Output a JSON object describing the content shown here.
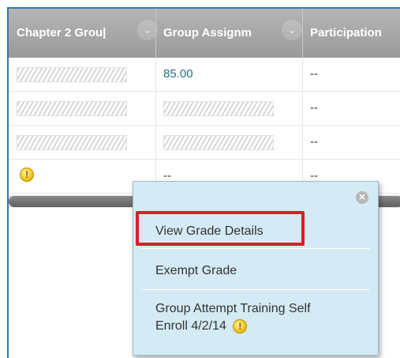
{
  "columns": [
    {
      "label": "Chapter 2 Grou|"
    },
    {
      "label": "Group Assignm"
    },
    {
      "label": "Participation"
    }
  ],
  "icons": {
    "sort": "chevron-down-icon",
    "warning": "exclamation-warning-icon",
    "close": "close-icon"
  },
  "rows": [
    {
      "col2": "85.00",
      "col3": "--"
    },
    {
      "col3": "--"
    },
    {
      "col3": "--"
    },
    {
      "col2": "--",
      "col3": "--"
    }
  ],
  "warning_glyph": "!",
  "popup": {
    "close_glyph": "✕",
    "items": [
      {
        "label": "View Grade Details"
      },
      {
        "label": "Exempt Grade"
      },
      {
        "label": "Group Attempt Training Self Enroll 4/2/14"
      }
    ]
  },
  "colors": {
    "frame": "#2f7db6",
    "header": "#a5a5a5",
    "popup": "#d4eaf4",
    "highlight": "#d81f26",
    "grade_link": "#2b6f8a"
  }
}
